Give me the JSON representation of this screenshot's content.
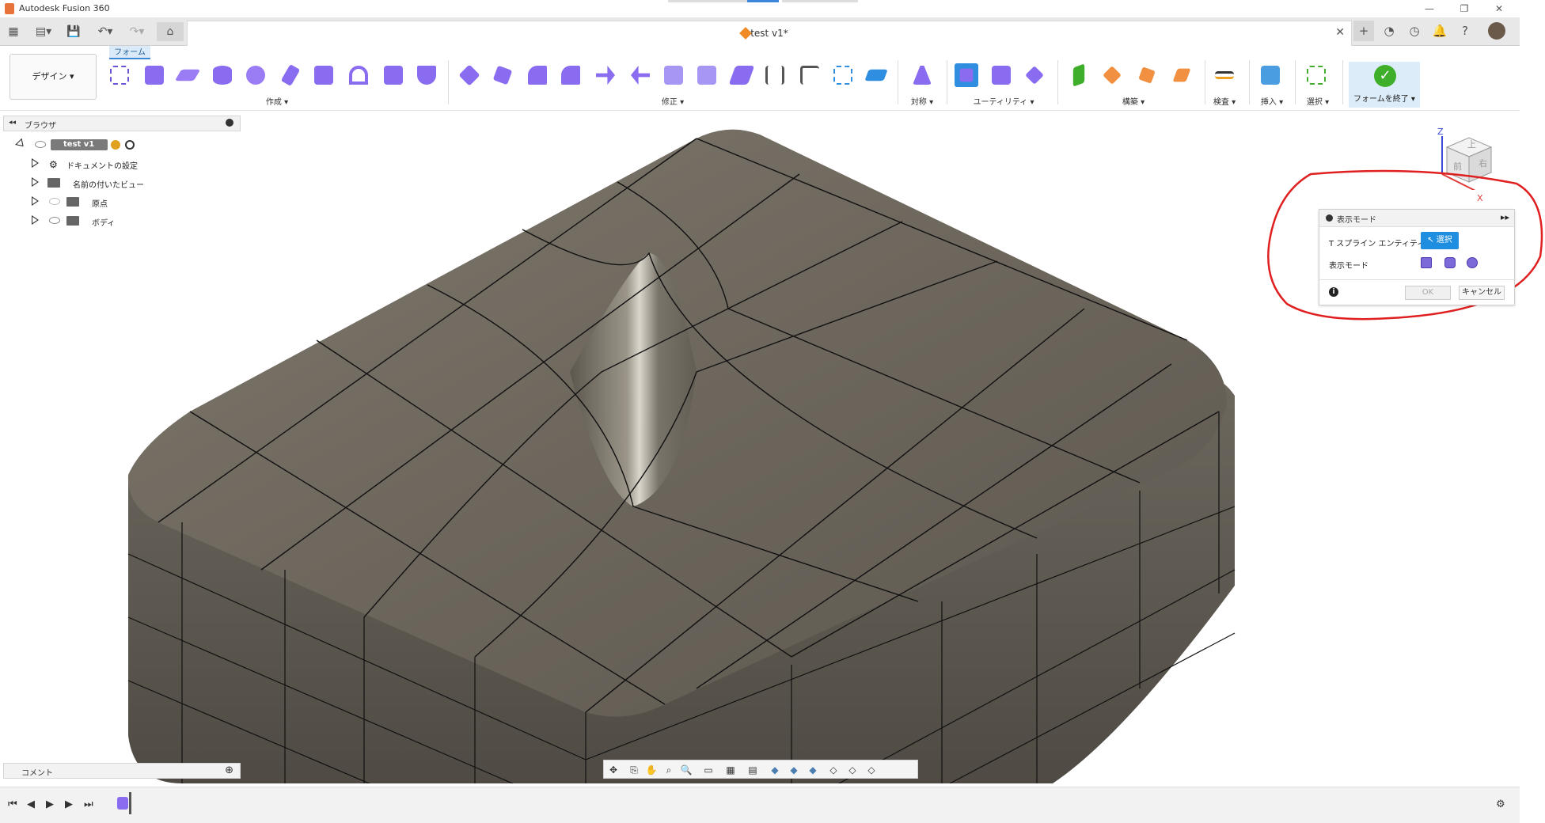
{
  "app": {
    "title": "Autodesk Fusion 360"
  },
  "document": {
    "tab_title": "test v1*"
  },
  "workspace": {
    "active_tab": "フォーム",
    "design_menu": "デザイン ▾"
  },
  "toolbar_groups": [
    {
      "label": "作成 ▾"
    },
    {
      "label": "修正 ▾"
    },
    {
      "label": "対称 ▾"
    },
    {
      "label": "ユーティリティ ▾"
    },
    {
      "label": "構築 ▾"
    },
    {
      "label": "検査 ▾"
    },
    {
      "label": "挿入 ▾"
    },
    {
      "label": "選択 ▾"
    }
  ],
  "finish_form": {
    "label": "フォームを終了 ▾"
  },
  "browser": {
    "title": "ブラウザ",
    "root": "test v1",
    "items": [
      {
        "label": "ドキュメントの設定"
      },
      {
        "label": "名前の付いたビュー"
      },
      {
        "label": "原点"
      },
      {
        "label": "ボディ"
      }
    ]
  },
  "comments": {
    "label": "コメント"
  },
  "viewcube": {
    "axis_z": "Z",
    "axis_x": "X",
    "face_top": "上",
    "face_front": "前",
    "face_right": "右"
  },
  "dialog": {
    "title": "表示モード",
    "row1_label": "T スプライン エンティティ",
    "select_button": "選択",
    "row2_label": "表示モード",
    "ok": "OK",
    "cancel": "キャンセル"
  },
  "colors": {
    "accent": "#1f8de0",
    "finish_green": "#3fae2a",
    "annotation": "#e02020",
    "body_surface": "#6f6a60"
  }
}
